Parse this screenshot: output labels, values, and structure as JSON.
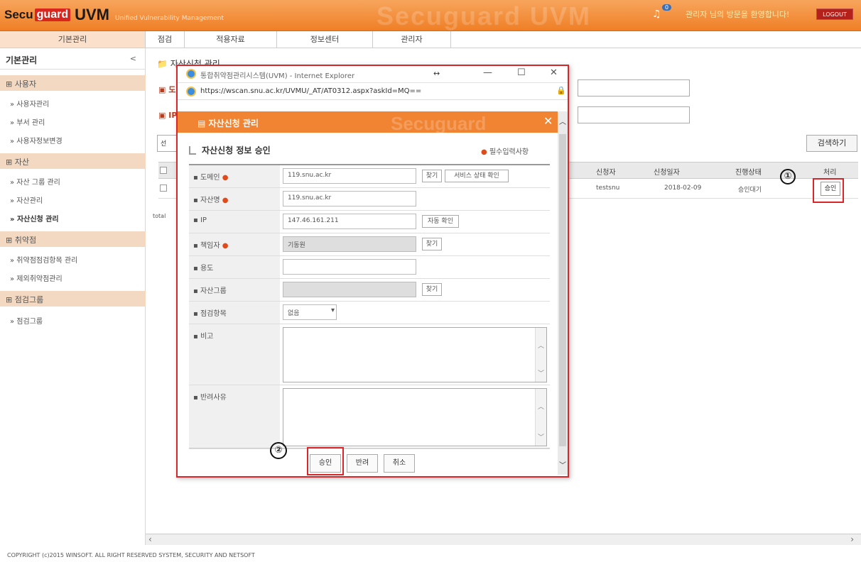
{
  "header": {
    "logo_secu": "Secu",
    "logo_guard": "guard",
    "logo_uvm": "UVM",
    "logo_sub": "Unified Vulnerability Management",
    "watermark": "Secuguard UVM",
    "bell_count": "0",
    "user_info": "관리자 님의 방문을 환영합니다!",
    "logout": "LOGOUT"
  },
  "nav": {
    "tabs": [
      {
        "label": "기본관리"
      },
      {
        "label": "점검"
      },
      {
        "label": "적용자료"
      },
      {
        "label": "정보센터"
      },
      {
        "label": "관리자"
      }
    ]
  },
  "sidebar": {
    "title": "기본관리",
    "toggle": "<",
    "groups": [
      {
        "label": "사용자",
        "items": [
          "사용자관리",
          "부서 관리",
          "사용자정보변경"
        ]
      },
      {
        "label": "자산",
        "items": [
          "자산 그룹 관리",
          "자산관리",
          "자산신청 관리"
        ]
      },
      {
        "label": "취약점",
        "items": [
          "취약점점검항목 관리",
          "제외취약점관리"
        ]
      },
      {
        "label": "점검그룹",
        "items": [
          "점검그룹"
        ]
      }
    ]
  },
  "main": {
    "breadcrumb": "자산신청 관리",
    "label_domain": "도",
    "label_ip": "IP",
    "search_btn": "검색하기",
    "search_opt": "선",
    "grid": {
      "headers": [
        "신청자",
        "신청일자",
        "진행상태",
        "처리"
      ],
      "row": {
        "applicant": "testsnu",
        "date": "2018-02-09",
        "status": "승인대기",
        "action": "승인"
      }
    },
    "total": "total"
  },
  "footer": "COPYRIGHT (c)2015 WINSOFT. ALL RIGHT RESERVED  SYSTEM, SECURITY AND NETSOFT",
  "popup": {
    "window_title": "통합취약점관리시스템(UVM) - Internet Explorer",
    "url": "https://wscan.snu.ac.kr/UVMU/_AT/AT0312.aspx?askId=MQ==",
    "header": "자산신청 관리",
    "header_wm": "Secuguard",
    "form_title": "자산신청 정보 승인",
    "required_note": "필수입력사항",
    "fields": {
      "domain": {
        "label": "도메인",
        "value": "119.snu.ac.kr",
        "btn_find": "찾기",
        "btn_check": "서비스 상태 확인"
      },
      "asset_name": {
        "label": "자산명",
        "value": "119.snu.ac.kr"
      },
      "ip": {
        "label": "IP",
        "value": "147.46.161.211",
        "btn": "자동 확인"
      },
      "owner": {
        "label": "책임자",
        "value": "기동원",
        "btn": "찾기"
      },
      "purpose": {
        "label": "용도",
        "value": ""
      },
      "asset_group": {
        "label": "자산그룹",
        "value": "",
        "btn": "찾기"
      },
      "check_item": {
        "label": "점검항목",
        "value": "없음"
      },
      "note": {
        "label": "비고"
      },
      "reject_reason": {
        "label": "반려사유"
      }
    },
    "buttons": {
      "approve": "승인",
      "reject": "반려",
      "cancel": "취소"
    }
  },
  "annotations": {
    "one": "①",
    "two": "②"
  }
}
